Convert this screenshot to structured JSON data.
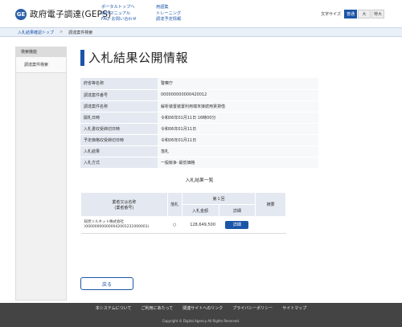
{
  "header": {
    "logo_icon": "GE",
    "logo_text": "政府電子調達(GEPS)",
    "links_col1": [
      "ポータルトップへ",
      "操作マニュアル",
      "FAQ･お問い合わせ"
    ],
    "links_col2": [
      "用語集",
      "トレーニング",
      "調達予定情報"
    ],
    "font_size_label": "文字サイズ",
    "font_sizes": [
      "普通",
      "大",
      "特大"
    ],
    "active_font_size": "普通",
    "accent": "#1b55a8"
  },
  "breadcrumb": {
    "items": [
      "入札結果確認トップ",
      "調達案件検索"
    ],
    "separator": ">"
  },
  "sidebar": {
    "heading": "検索機能",
    "items": [
      "調達案件検索"
    ]
  },
  "main": {
    "title": "入札結果公開情報",
    "info_rows": [
      {
        "label": "府省等名称",
        "value": "警察庁"
      },
      {
        "label": "調達案件番号",
        "value": "000000000000420012"
      },
      {
        "label": "調達案件名称",
        "value": "解析装置装置利用端末接続用賃貸借"
      },
      {
        "label": "開札日時",
        "value": "令和06年01月11日 16時00分"
      },
      {
        "label": "入札書収受締切日時",
        "value": "令和06年01月11日"
      },
      {
        "label": "予定価格収受締切日時",
        "value": "令和06年01月11日"
      },
      {
        "label": "入札結果",
        "value": "落札"
      },
      {
        "label": "入札方式",
        "value": "一般競争･最低価格"
      }
    ],
    "results_title": "入札結果一覧",
    "results_table": {
      "headers": {
        "supplier": "業者又は名称\n(業者番号)",
        "award": "落札",
        "round": "第１回",
        "amount": "入札金額",
        "detail": "詳細",
        "note": "摘要"
      },
      "rows": [
        {
          "supplier": "知見ソルネット株式会社\n(000000000000042001231000001)",
          "award": "○",
          "amount": "128,649,500",
          "detail_button": "詳細",
          "note": ""
        }
      ]
    },
    "back_button": "戻る"
  },
  "footer": {
    "links": [
      "本システムについて",
      "ご利用にあたって",
      "関連サイトへのリンク",
      "プライバシーポリシー",
      "サイトマップ"
    ],
    "copyright": "Copyright © Digital Agency All Rights Reserved."
  }
}
